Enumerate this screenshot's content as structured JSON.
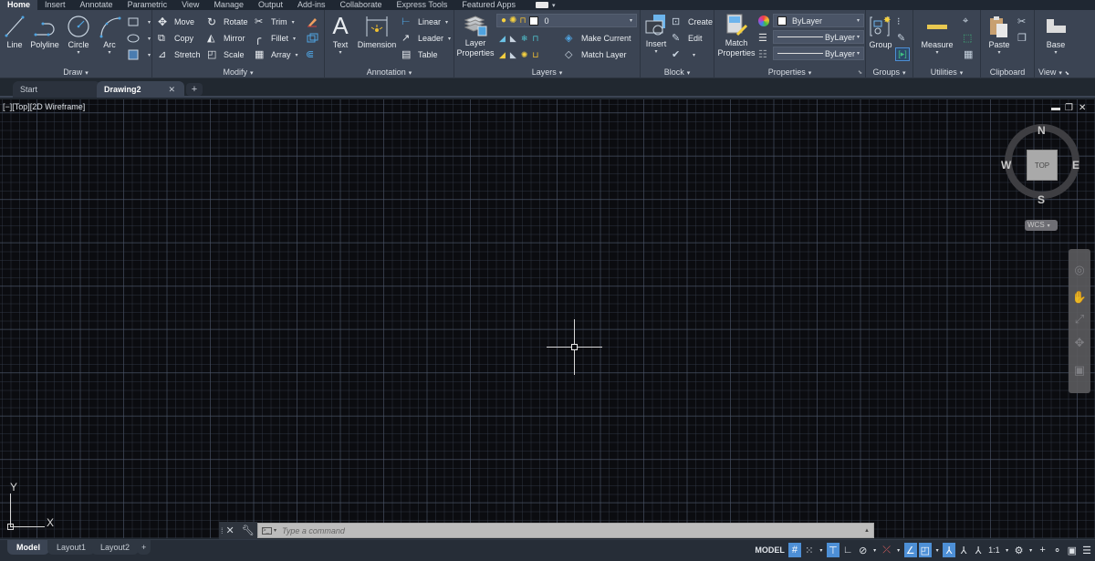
{
  "menu": {
    "tabs": [
      "Home",
      "Insert",
      "Annotate",
      "Parametric",
      "View",
      "Manage",
      "Output",
      "Add-ins",
      "Collaborate",
      "Express Tools",
      "Featured Apps"
    ],
    "active": "Home"
  },
  "ribbon": {
    "draw": {
      "title": "Draw",
      "line": "Line",
      "polyline": "Polyline",
      "circle": "Circle",
      "arc": "Arc"
    },
    "modify": {
      "title": "Modify",
      "move": "Move",
      "rotate": "Rotate",
      "trim": "Trim",
      "copy": "Copy",
      "mirror": "Mirror",
      "fillet": "Fillet",
      "stretch": "Stretch",
      "scale": "Scale",
      "array": "Array"
    },
    "annotation": {
      "title": "Annotation",
      "text": "Text",
      "dimension": "Dimension",
      "linear": "Linear",
      "leader": "Leader",
      "table": "Table"
    },
    "layers": {
      "title": "Layers",
      "layer_properties_1": "Layer",
      "layer_properties_2": "Properties",
      "current_layer": "0",
      "make_current": "Make Current",
      "match_layer": "Match Layer"
    },
    "block": {
      "title": "Block",
      "insert": "Insert",
      "create": "Create",
      "edit": "Edit"
    },
    "properties": {
      "title": "Properties",
      "match_1": "Match",
      "match_2": "Properties",
      "color": "ByLayer",
      "lineweight": "ByLayer",
      "linetype": "ByLayer"
    },
    "groups": {
      "title": "Groups",
      "group": "Group"
    },
    "utilities": {
      "title": "Utilities",
      "measure": "Measure"
    },
    "clipboard": {
      "title": "Clipboard",
      "paste": "Paste"
    },
    "view": {
      "title": "View",
      "base": "Base"
    }
  },
  "file_tabs": {
    "start": "Start",
    "drawing": "Drawing2",
    "close": "✕",
    "add": "+"
  },
  "viewport": {
    "label": "[−][Top][2D Wireframe]",
    "viewcube": {
      "face": "TOP",
      "n": "N",
      "s": "S",
      "e": "E",
      "w": "W",
      "ucs": "WCS"
    },
    "ucs_x": "X",
    "ucs_y": "Y"
  },
  "command": {
    "placeholder": "Type a command"
  },
  "layout_tabs": [
    "Model",
    "Layout1",
    "Layout2"
  ],
  "status": {
    "model": "MODEL",
    "scale": "1:1"
  }
}
